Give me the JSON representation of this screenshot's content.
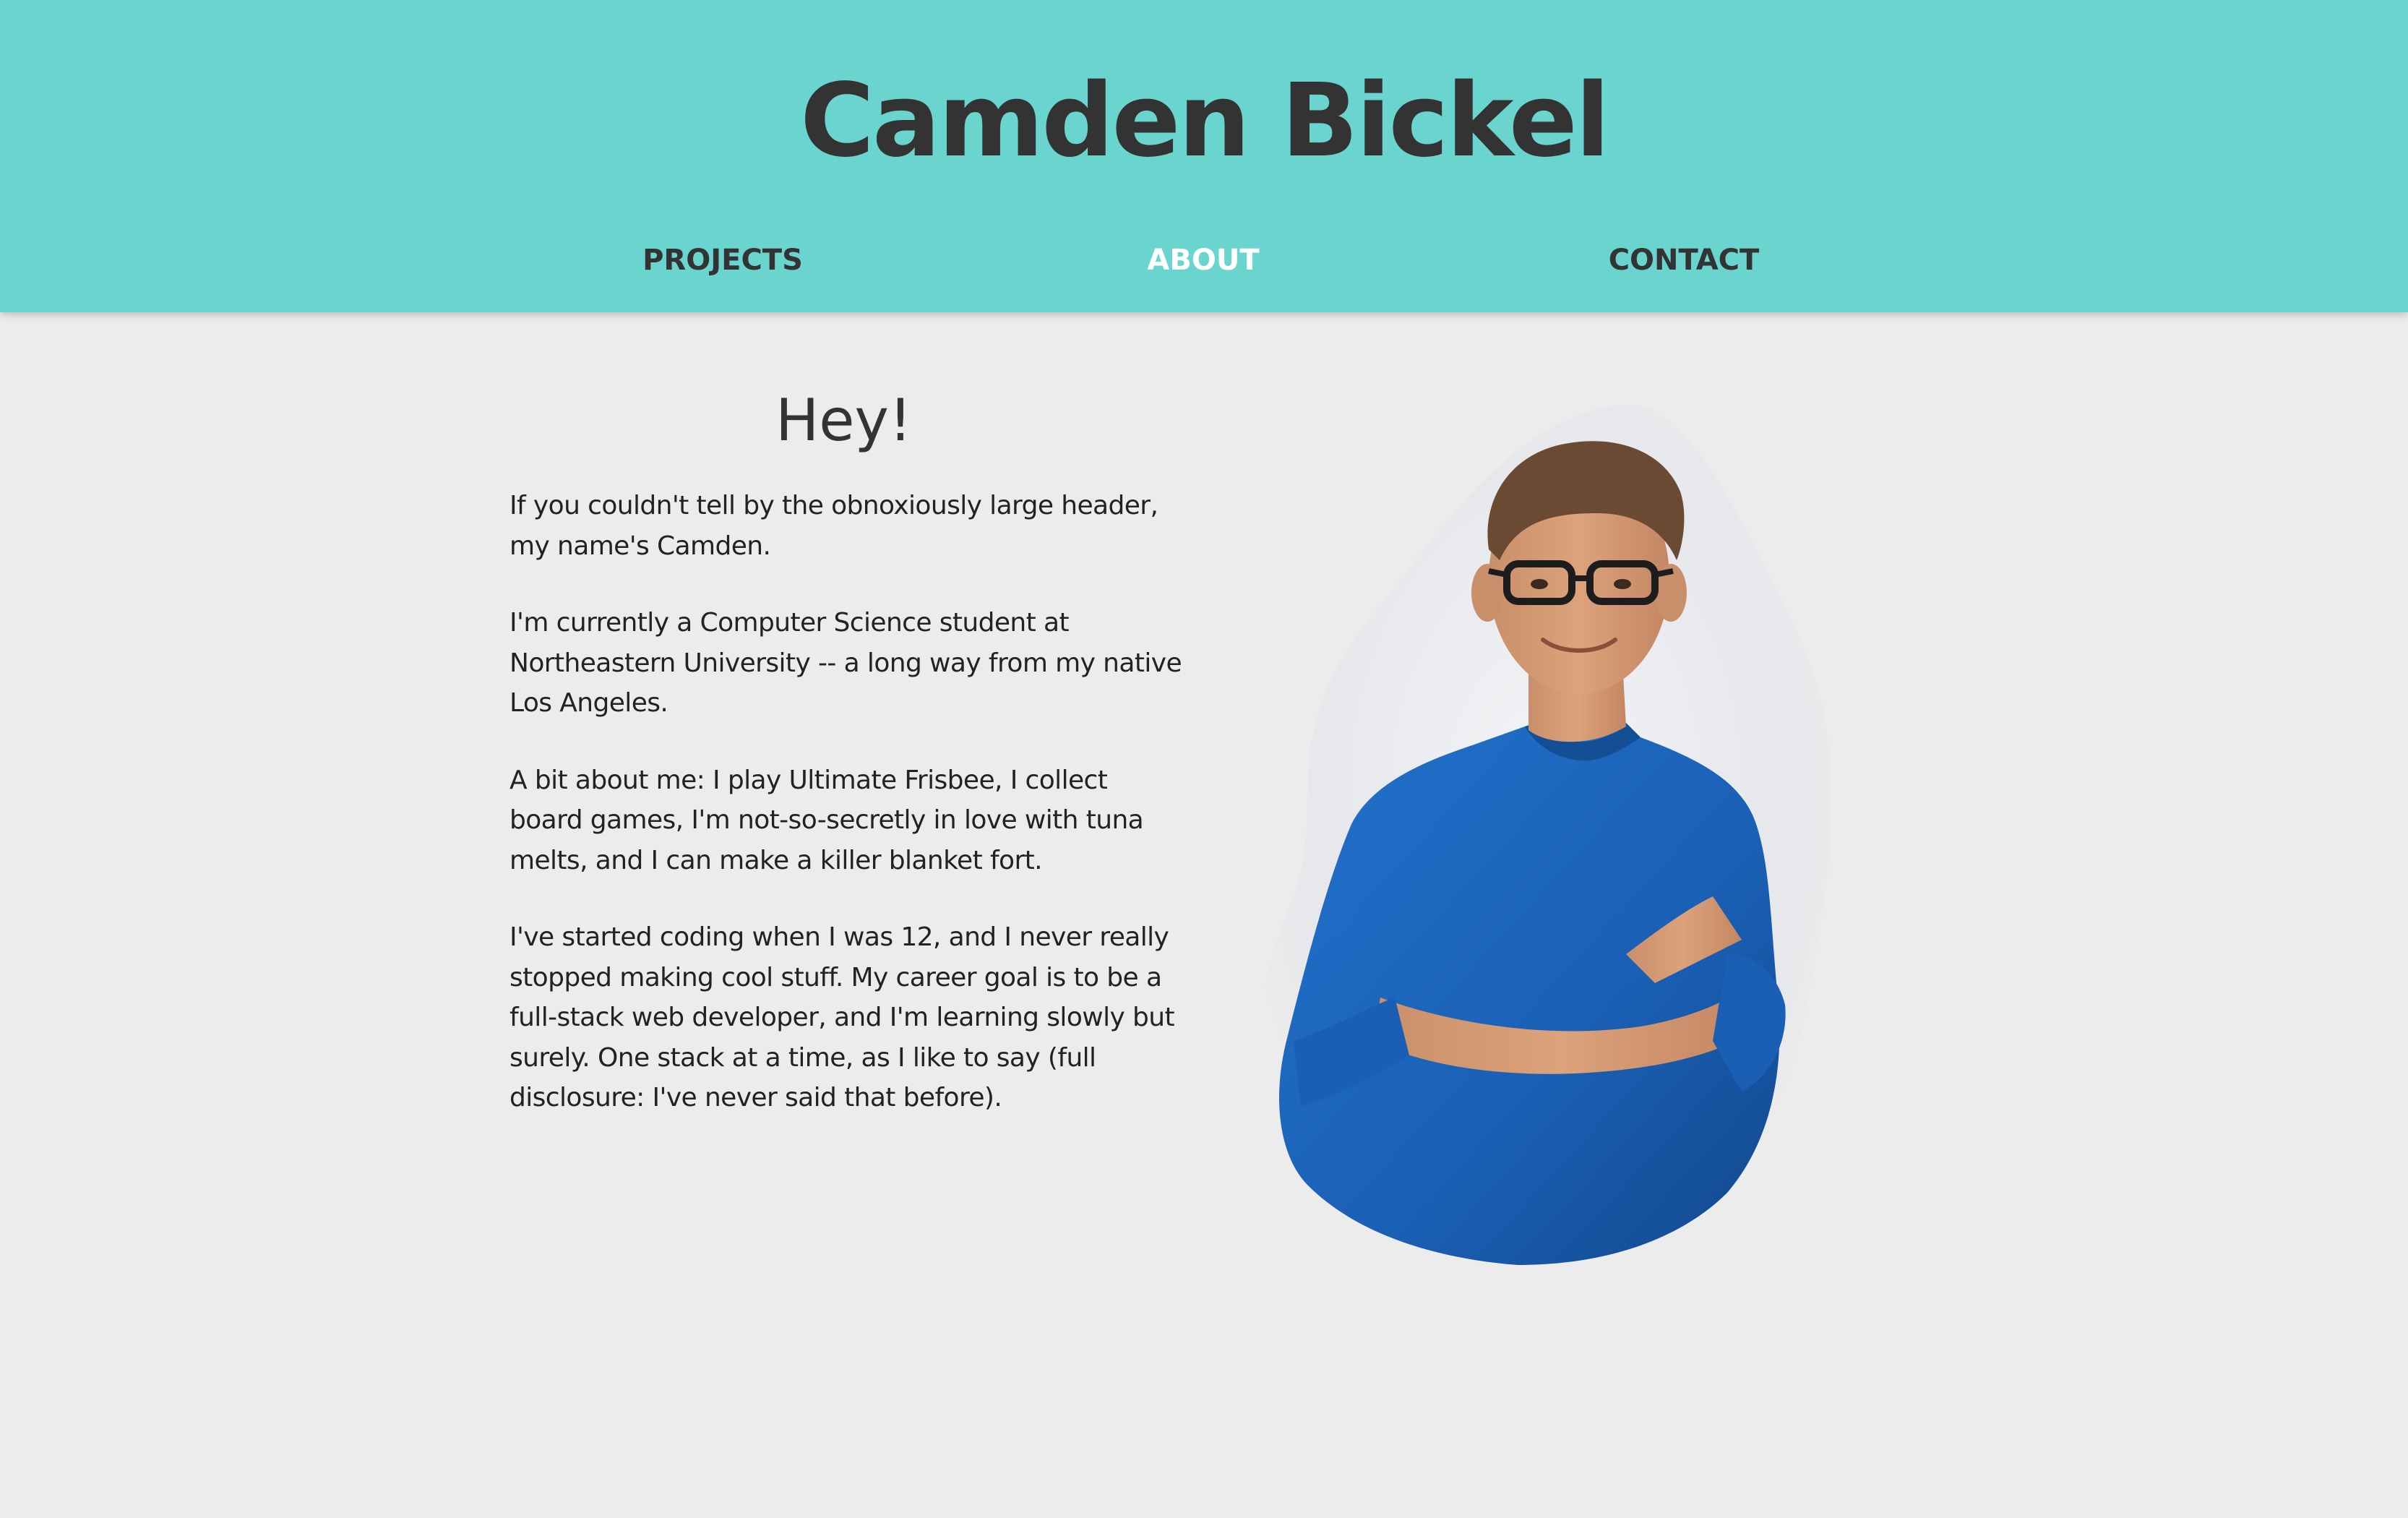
{
  "header": {
    "title": "Camden Bickel",
    "nav": {
      "projects": "PROJECTS",
      "about": "ABOUT",
      "contact": "CONTACT"
    }
  },
  "main": {
    "greeting": "Hey!",
    "paragraphs": [
      "If you couldn't tell by the obnoxiously large header, my name's Camden.",
      "I'm currently a Computer Science student at Northeastern University -- a long way from my native Los Angeles.",
      "A bit about me: I play Ultimate Frisbee, I collect board games, I'm not-so-secretly in love with tuna melts, and I can make a killer blanket fort.",
      "I've started coding when I was 12, and I never really stopped making cool stuff. My career goal is to be a full-stack web developer, and I'm learning slowly but surely. One stack at a time, as I like to say (full disclosure: I've never said that before)."
    ]
  },
  "colors": {
    "header_bg": "#6ad4cf",
    "page_bg": "#ececec",
    "text_dark": "#333333",
    "nav_active": "#ffffff",
    "shirt_blue": "#1a5fb4"
  }
}
